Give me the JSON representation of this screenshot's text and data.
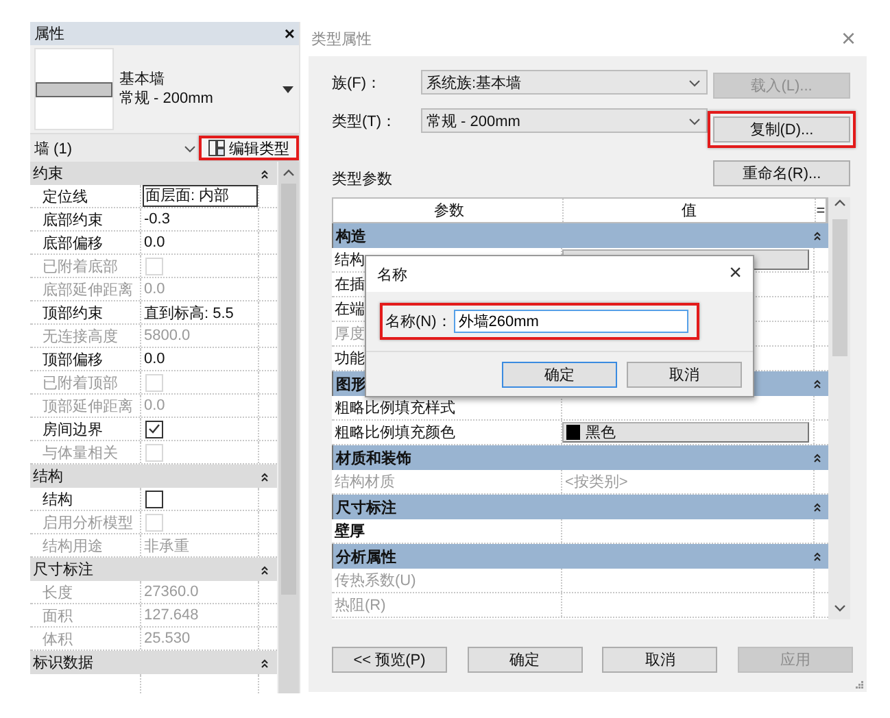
{
  "properties_panel": {
    "title": "属性",
    "close": "×",
    "type_name": "基本墙",
    "type_size": "常规 - 200mm",
    "selector": "墙 (1)",
    "edit_type_button": {
      "label": "编辑类型",
      "highlighted": true
    },
    "groups": [
      {
        "title": "约束",
        "rows": [
          {
            "label": "定位线",
            "kind": "text",
            "value": "面层面: 内部",
            "disabled": false,
            "editing": true
          },
          {
            "label": "底部约束",
            "kind": "text",
            "value": "-0.3",
            "disabled": false
          },
          {
            "label": "底部偏移",
            "kind": "text",
            "value": "0.0",
            "disabled": false
          },
          {
            "label": "已附着底部",
            "kind": "check",
            "checked": false,
            "disabled": true
          },
          {
            "label": "底部延伸距离",
            "kind": "text",
            "value": "0.0",
            "disabled": true
          },
          {
            "label": "顶部约束",
            "kind": "text",
            "value": "直到标高: 5.5",
            "disabled": false
          },
          {
            "label": "无连接高度",
            "kind": "text",
            "value": "5800.0",
            "disabled": true
          },
          {
            "label": "顶部偏移",
            "kind": "text",
            "value": "0.0",
            "disabled": false
          },
          {
            "label": "已附着顶部",
            "kind": "check",
            "checked": false,
            "disabled": true
          },
          {
            "label": "顶部延伸距离",
            "kind": "text",
            "value": "0.0",
            "disabled": true
          },
          {
            "label": "房间边界",
            "kind": "check",
            "checked": true,
            "disabled": false
          },
          {
            "label": "与体量相关",
            "kind": "check",
            "checked": false,
            "disabled": true
          }
        ]
      },
      {
        "title": "结构",
        "rows": [
          {
            "label": "结构",
            "kind": "check",
            "checked": false,
            "disabled": false
          },
          {
            "label": "启用分析模型",
            "kind": "check",
            "checked": false,
            "disabled": true
          },
          {
            "label": "结构用途",
            "kind": "text",
            "value": "非承重",
            "disabled": true
          }
        ]
      },
      {
        "title": "尺寸标注",
        "rows": [
          {
            "label": "长度",
            "kind": "text",
            "value": "27360.0",
            "disabled": true
          },
          {
            "label": "面积",
            "kind": "text",
            "value": "127.648",
            "disabled": true
          },
          {
            "label": "体积",
            "kind": "text",
            "value": "25.530",
            "disabled": true
          }
        ]
      },
      {
        "title": "标识数据"
      }
    ]
  },
  "type_dialog": {
    "title": "类型属性",
    "close": "×",
    "family": {
      "label": "族(F)：",
      "value": "系统族:基本墙"
    },
    "type": {
      "label": "类型(T)：",
      "value": "常规 - 200mm"
    },
    "side_buttons": [
      {
        "label": "载入(L)...",
        "disabled": true
      },
      {
        "label": "复制(D)...",
        "disabled": false,
        "highlighted": true
      },
      {
        "label": "重命名(R)...",
        "disabled": false
      }
    ],
    "section_label": "类型参数",
    "table": {
      "columns": [
        "参数",
        "值",
        "="
      ],
      "groups": [
        {
          "title": "构造",
          "rows": [
            {
              "label": "结构",
              "value": "",
              "kind": "button",
              "disabled": false
            },
            {
              "label": "在插",
              "value": "",
              "kind": "text",
              "disabled": false
            },
            {
              "label": "在端",
              "value": "",
              "kind": "text",
              "disabled": false
            },
            {
              "label": "厚度",
              "value": "",
              "kind": "text",
              "disabled": true
            },
            {
              "label": "功能",
              "value": "",
              "kind": "text",
              "disabled": false
            }
          ]
        },
        {
          "title": "图形",
          "rows": [
            {
              "label": "粗略比例填充样式",
              "value": "",
              "kind": "text",
              "disabled": false
            },
            {
              "label": "粗略比例填充颜色",
              "value": "黑色",
              "kind": "color",
              "color": "#000000",
              "disabled": false
            }
          ]
        },
        {
          "title": "材质和装饰",
          "rows": [
            {
              "label": "结构材质",
              "value": "<按类别>",
              "kind": "text",
              "disabled": true
            }
          ]
        },
        {
          "title": "尺寸标注",
          "rows": [
            {
              "label": "壁厚",
              "value": "",
              "kind": "text",
              "disabled": false
            }
          ]
        },
        {
          "title": "分析属性",
          "rows": [
            {
              "label": "传热系数(U)",
              "value": "",
              "kind": "text",
              "disabled": true
            },
            {
              "label": "热阻(R)",
              "value": "",
              "kind": "text",
              "disabled": true
            }
          ]
        }
      ]
    },
    "buttons": [
      {
        "label": "<< 预览(P)",
        "disabled": false
      },
      {
        "label": "确定",
        "disabled": false
      },
      {
        "label": "取消",
        "disabled": false
      },
      {
        "label": "应用",
        "disabled": true
      }
    ]
  },
  "name_dialog": {
    "title": "名称",
    "close": "×",
    "field_label": "名称(N)：",
    "value": "外墙260mm",
    "highlighted": true,
    "buttons": [
      {
        "label": "确定",
        "focused": true
      },
      {
        "label": "取消",
        "focused": false
      }
    ]
  }
}
